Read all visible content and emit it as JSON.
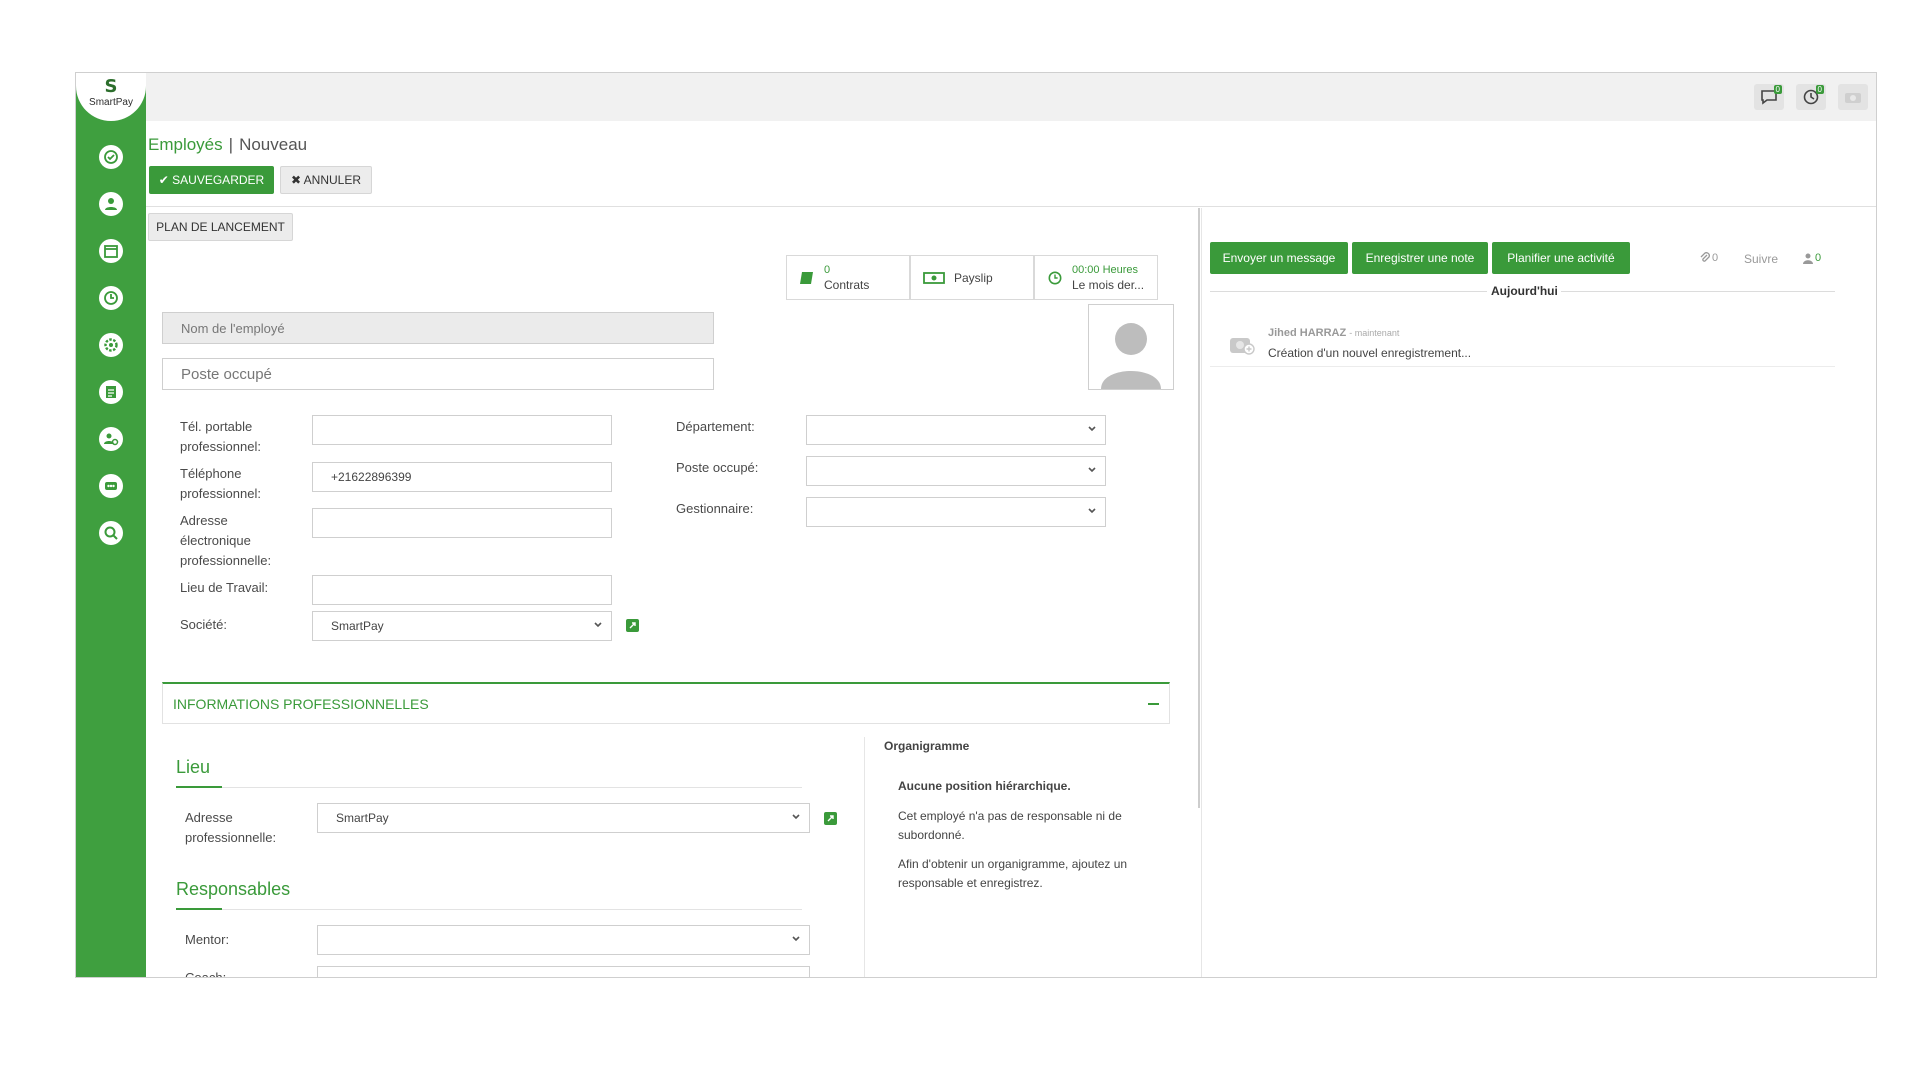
{
  "logo": {
    "mark": "S",
    "text": "SmartPay"
  },
  "sidebar": {
    "items": [
      {
        "icon": "dashboard-icon"
      },
      {
        "icon": "employees-icon"
      },
      {
        "icon": "calendar-icon"
      },
      {
        "icon": "clock-icon"
      },
      {
        "icon": "settings-gear-icon"
      },
      {
        "icon": "document-icon"
      },
      {
        "icon": "user-settings-icon"
      },
      {
        "icon": "training-icon"
      },
      {
        "icon": "search-gear-icon"
      }
    ]
  },
  "topbar": {
    "messages_count": "0",
    "activities_count": "0"
  },
  "breadcrumb": {
    "parent": "Employés",
    "separator": "|",
    "current": "Nouveau"
  },
  "toolbar": {
    "save_label": "✔ SAUVEGARDER",
    "cancel_label": "✖ ANNULER",
    "plan_label": "PLAN DE LANCEMENT"
  },
  "stats": {
    "contracts_count": "0",
    "contracts_label": "Contrats",
    "payslip_label": "Payslip",
    "hours_value": "00:00 Heures",
    "hours_period": "Le mois der..."
  },
  "employee": {
    "name_placeholder": "Nom de l'employé",
    "job_placeholder": "Poste occupé"
  },
  "form": {
    "mobile_label_1": "Tél. portable",
    "mobile_label_2": "professionnel:",
    "mobile_value": "",
    "phone_label_1": "Téléphone",
    "phone_label_2": "professionnel:",
    "phone_value": "+21622896399",
    "email_label_1": "Adresse",
    "email_label_2": "électronique",
    "email_label_3": "professionnelle:",
    "email_value": "",
    "workplace_label": "Lieu de Travail:",
    "workplace_value": "",
    "company_label": "Société:",
    "company_value": "SmartPay",
    "department_label": "Département:",
    "department_value": "",
    "position_label": "Poste occupé:",
    "position_value": "",
    "manager_label": "Gestionnaire:",
    "manager_value": ""
  },
  "pro_section": {
    "title": "INFORMATIONS PROFESSIONNELLES",
    "lieu_title": "Lieu",
    "address_label_1": "Adresse",
    "address_label_2": "professionnelle:",
    "address_value": "SmartPay",
    "responsables_title": "Responsables",
    "mentor_label": "Mentor:",
    "mentor_value": "",
    "next_label_partial": "Coach:",
    "org_title": "Organigramme",
    "org_empty_title": "Aucune position hiérarchique.",
    "org_line_1": "Cet employé n'a pas de responsable ni de",
    "org_line_2": "subordonné.",
    "org_line_3": "Afin d'obtenir un organigramme, ajoutez un",
    "org_line_4": "responsable et enregistrez."
  },
  "chatter": {
    "send_message": "Envoyer un message",
    "log_note": "Enregistrer une note",
    "schedule_activity": "Planifier une activité",
    "attachments_count": "0",
    "follow_label": "Suivre",
    "followers_count": "0",
    "today_label": "Aujourd'hui",
    "author": "Jihed HARRAZ",
    "time": "- maintenant",
    "message": "Création d'un nouvel enregistrement..."
  },
  "colors": {
    "brand_green": "#3a9a3a",
    "sidebar_green": "#3f9f3f"
  }
}
